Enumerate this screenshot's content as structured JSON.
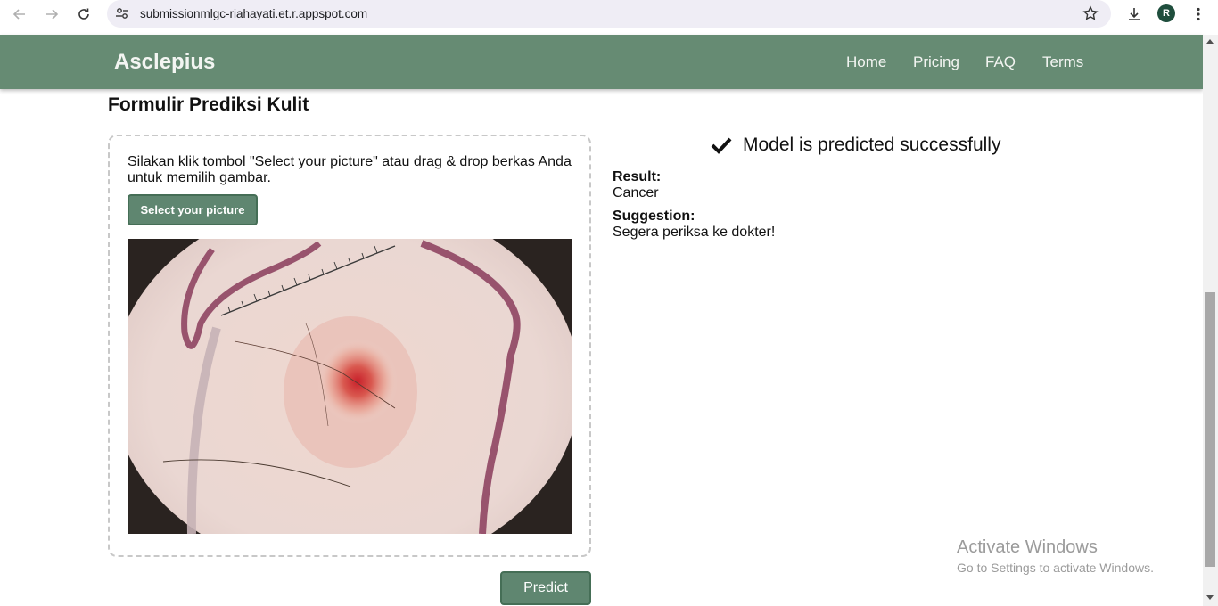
{
  "browser": {
    "url": "submissionmlgc-riahayati.et.r.appspot.com",
    "profile_initial": "R"
  },
  "header": {
    "brand": "Asclepius",
    "nav": [
      "Home",
      "Pricing",
      "FAQ",
      "Terms"
    ]
  },
  "main": {
    "title": "Formulir Prediksi Kulit",
    "instructions": "Silakan klik tombol \"Select your picture\" atau drag & drop berkas Anda untuk memilih gambar.",
    "select_label": "Select your picture",
    "predict_label": "Predict"
  },
  "result": {
    "status": "Model is predicted successfully",
    "result_label": "Result:",
    "result_value": "Cancer",
    "suggestion_label": "Suggestion:",
    "suggestion_value": "Segera periksa ke dokter!"
  },
  "watermark": {
    "line1": "Activate Windows",
    "line2": "Go to Settings to activate Windows."
  },
  "colors": {
    "brand_green": "#668b73",
    "button_green": "#5f8670"
  },
  "icons": [
    "back-icon",
    "forward-icon",
    "reload-icon",
    "site-settings-icon",
    "bookmark-star-icon",
    "download-icon",
    "more-vert-icon",
    "check-icon"
  ]
}
